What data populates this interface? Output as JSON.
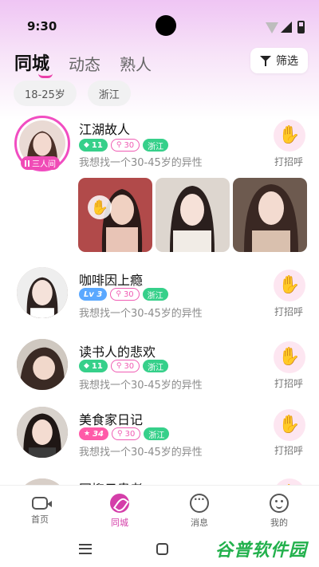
{
  "status": {
    "time": "9:30"
  },
  "tabs": [
    {
      "label": "同城",
      "active": true
    },
    {
      "label": "动态",
      "active": false
    },
    {
      "label": "熟人",
      "active": false
    }
  ],
  "filter": {
    "label": "筛选"
  },
  "chips": [
    "18-25岁",
    "浙江"
  ],
  "users": [
    {
      "name": "江湖故人",
      "badge": "三人间",
      "level": "11",
      "age": "30",
      "province": "浙江",
      "bio": "我想找一个30-45岁的异性",
      "action": "打招呼"
    },
    {
      "name": "咖啡因上瘾",
      "level": "Lv 3",
      "age": "30",
      "province": "浙江",
      "bio": "我想找一个30-45岁的异性",
      "action": "打招呼"
    },
    {
      "name": "读书人的悲欢",
      "level": "11",
      "age": "30",
      "province": "浙江",
      "bio": "我想找一个30-45岁的异性",
      "action": "打招呼"
    },
    {
      "name": "美食家日记",
      "level": "34",
      "age": "30",
      "province": "浙江",
      "bio": "我想找一个30-45岁的异性",
      "action": "打招呼"
    },
    {
      "name": "网抑云患者"
    }
  ],
  "tabbar": [
    {
      "label": "首页",
      "icon": "video-icon"
    },
    {
      "label": "同城",
      "icon": "city-icon",
      "active": true
    },
    {
      "label": "消息",
      "icon": "message-icon"
    },
    {
      "label": "我的",
      "icon": "profile-icon"
    }
  ],
  "watermark": "谷普软件园",
  "colors": {
    "accent": "#d43ea9",
    "green_tag": "#36d08a",
    "pink_tag": "#f05cb3",
    "blue_tag": "#5aa8ff"
  }
}
